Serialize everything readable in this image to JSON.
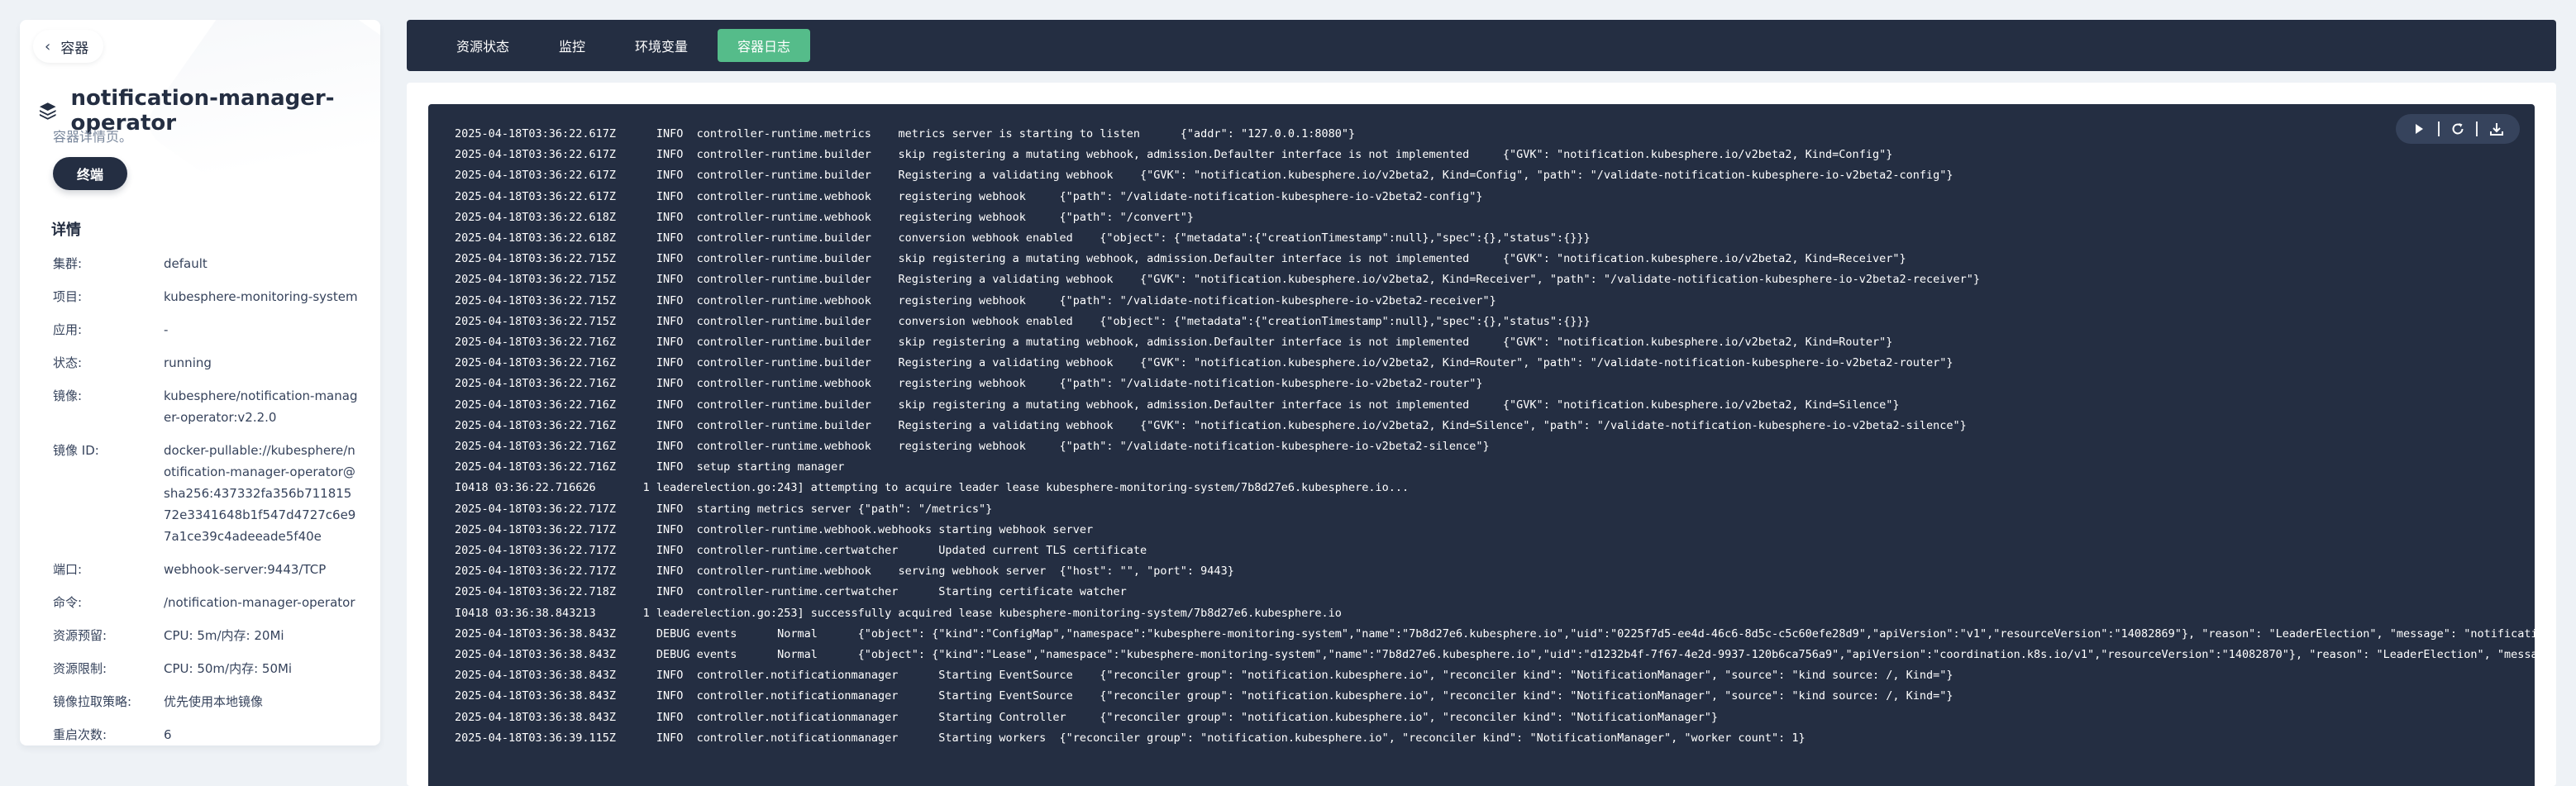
{
  "back": {
    "label": "容器"
  },
  "header": {
    "title": "notification-manager-operator",
    "subtitle": "容器详情页。",
    "terminal_label": "终端"
  },
  "details": {
    "heading": "详情",
    "rows": [
      {
        "key": "集群:",
        "value": "default"
      },
      {
        "key": "项目:",
        "value": "kubesphere-monitoring-system"
      },
      {
        "key": "应用:",
        "value": "-"
      },
      {
        "key": "状态:",
        "value": "running"
      },
      {
        "key": "镜像:",
        "value": "kubesphere/notification-manager-operator:v2.2.0"
      },
      {
        "key": "镜像 ID:",
        "value": "docker-pullable://kubesphere/notification-manager-operator@sha256:437332fa356b71181572e3341648b1f547d4727c6e97a1ce39c4adeeade5f40e"
      },
      {
        "key": "端口:",
        "value": "webhook-server:9443/TCP"
      },
      {
        "key": "命令:",
        "value": "/notification-manager-operator"
      },
      {
        "key": "资源预留:",
        "value": "CPU:  5m/内存:  20Mi"
      },
      {
        "key": "资源限制:",
        "value": "CPU:  50m/内存:  50Mi"
      },
      {
        "key": "镜像拉取策略:",
        "value": "优先使用本地镜像"
      },
      {
        "key": "重启次数:",
        "value": "6"
      }
    ]
  },
  "tabs": [
    {
      "label": "资源状态",
      "active": false
    },
    {
      "label": "监控",
      "active": false
    },
    {
      "label": "环境变量",
      "active": false
    },
    {
      "label": "容器日志",
      "active": true
    }
  ],
  "logs": [
    "2025-04-18T03:36:22.617Z\tINFO\tcontroller-runtime.metrics\tmetrics server is starting to listen\t{\"addr\": \"127.0.0.1:8080\"}",
    "2025-04-18T03:36:22.617Z\tINFO\tcontroller-runtime.builder\tskip registering a mutating webhook, admission.Defaulter interface is not implemented\t{\"GVK\": \"notification.kubesphere.io/v2beta2, Kind=Config\"}",
    "2025-04-18T03:36:22.617Z\tINFO\tcontroller-runtime.builder\tRegistering a validating webhook\t{\"GVK\": \"notification.kubesphere.io/v2beta2, Kind=Config\", \"path\": \"/validate-notification-kubesphere-io-v2beta2-config\"}",
    "2025-04-18T03:36:22.617Z\tINFO\tcontroller-runtime.webhook\tregistering webhook\t{\"path\": \"/validate-notification-kubesphere-io-v2beta2-config\"}",
    "2025-04-18T03:36:22.618Z\tINFO\tcontroller-runtime.webhook\tregistering webhook\t{\"path\": \"/convert\"}",
    "2025-04-18T03:36:22.618Z\tINFO\tcontroller-runtime.builder\tconversion webhook enabled\t{\"object\": {\"metadata\":{\"creationTimestamp\":null},\"spec\":{},\"status\":{}}}",
    "2025-04-18T03:36:22.715Z\tINFO\tcontroller-runtime.builder\tskip registering a mutating webhook, admission.Defaulter interface is not implemented\t{\"GVK\": \"notification.kubesphere.io/v2beta2, Kind=Receiver\"}",
    "2025-04-18T03:36:22.715Z\tINFO\tcontroller-runtime.builder\tRegistering a validating webhook\t{\"GVK\": \"notification.kubesphere.io/v2beta2, Kind=Receiver\", \"path\": \"/validate-notification-kubesphere-io-v2beta2-receiver\"}",
    "2025-04-18T03:36:22.715Z\tINFO\tcontroller-runtime.webhook\tregistering webhook\t{\"path\": \"/validate-notification-kubesphere-io-v2beta2-receiver\"}",
    "2025-04-18T03:36:22.715Z\tINFO\tcontroller-runtime.builder\tconversion webhook enabled\t{\"object\": {\"metadata\":{\"creationTimestamp\":null},\"spec\":{},\"status\":{}}}",
    "2025-04-18T03:36:22.716Z\tINFO\tcontroller-runtime.builder\tskip registering a mutating webhook, admission.Defaulter interface is not implemented\t{\"GVK\": \"notification.kubesphere.io/v2beta2, Kind=Router\"}",
    "2025-04-18T03:36:22.716Z\tINFO\tcontroller-runtime.builder\tRegistering a validating webhook\t{\"GVK\": \"notification.kubesphere.io/v2beta2, Kind=Router\", \"path\": \"/validate-notification-kubesphere-io-v2beta2-router\"}",
    "2025-04-18T03:36:22.716Z\tINFO\tcontroller-runtime.webhook\tregistering webhook\t{\"path\": \"/validate-notification-kubesphere-io-v2beta2-router\"}",
    "2025-04-18T03:36:22.716Z\tINFO\tcontroller-runtime.builder\tskip registering a mutating webhook, admission.Defaulter interface is not implemented\t{\"GVK\": \"notification.kubesphere.io/v2beta2, Kind=Silence\"}",
    "2025-04-18T03:36:22.716Z\tINFO\tcontroller-runtime.builder\tRegistering a validating webhook\t{\"GVK\": \"notification.kubesphere.io/v2beta2, Kind=Silence\", \"path\": \"/validate-notification-kubesphere-io-v2beta2-silence\"}",
    "2025-04-18T03:36:22.716Z\tINFO\tcontroller-runtime.webhook\tregistering webhook\t{\"path\": \"/validate-notification-kubesphere-io-v2beta2-silence\"}",
    "2025-04-18T03:36:22.716Z\tINFO\tsetup\tstarting manager",
    "I0418 03:36:22.716626       1 leaderelection.go:243] attempting to acquire leader lease kubesphere-monitoring-system/7b8d27e6.kubesphere.io...",
    "2025-04-18T03:36:22.717Z\tINFO\tstarting metrics server\t{\"path\": \"/metrics\"}",
    "2025-04-18T03:36:22.717Z\tINFO\tcontroller-runtime.webhook.webhooks\tstarting webhook server",
    "2025-04-18T03:36:22.717Z\tINFO\tcontroller-runtime.certwatcher\tUpdated current TLS certificate",
    "2025-04-18T03:36:22.717Z\tINFO\tcontroller-runtime.webhook\tserving webhook server\t{\"host\": \"\", \"port\": 9443}",
    "2025-04-18T03:36:22.718Z\tINFO\tcontroller-runtime.certwatcher\tStarting certificate watcher",
    "I0418 03:36:38.843213       1 leaderelection.go:253] successfully acquired lease kubesphere-monitoring-system/7b8d27e6.kubesphere.io",
    "2025-04-18T03:36:38.843Z\tDEBUG\tevents\tNormal\t{\"object\": {\"kind\":\"ConfigMap\",\"namespace\":\"kubesphere-monitoring-system\",\"name\":\"7b8d27e6.kubesphere.io\",\"uid\":\"0225f7d5-ee4d-46c6-8d5c-c5c60efe28d9\",\"apiVersion\":\"v1\",\"resourceVersion\":\"14082869\"}, \"reason\": \"LeaderElection\", \"message\": \"notificatio",
    "2025-04-18T03:36:38.843Z\tDEBUG\tevents\tNormal\t{\"object\": {\"kind\":\"Lease\",\"namespace\":\"kubesphere-monitoring-system\",\"name\":\"7b8d27e6.kubesphere.io\",\"uid\":\"d1232b4f-7f67-4e2d-9937-120b6ca756a9\",\"apiVersion\":\"coordination.k8s.io/v1\",\"resourceVersion\":\"14082870\"}, \"reason\": \"LeaderElection\", \"messag",
    "2025-04-18T03:36:38.843Z\tINFO\tcontroller.notificationmanager\tStarting EventSource\t{\"reconciler group\": \"notification.kubesphere.io\", \"reconciler kind\": \"NotificationManager\", \"source\": \"kind source: /, Kind=\"}",
    "2025-04-18T03:36:38.843Z\tINFO\tcontroller.notificationmanager\tStarting EventSource\t{\"reconciler group\": \"notification.kubesphere.io\", \"reconciler kind\": \"NotificationManager\", \"source\": \"kind source: /, Kind=\"}",
    "2025-04-18T03:36:38.843Z\tINFO\tcontroller.notificationmanager\tStarting Controller\t{\"reconciler group\": \"notification.kubesphere.io\", \"reconciler kind\": \"NotificationManager\"}",
    "2025-04-18T03:36:39.115Z\tINFO\tcontroller.notificationmanager\tStarting workers\t{\"reconciler group\": \"notification.kubesphere.io\", \"reconciler kind\": \"NotificationManager\", \"worker count\": 1}"
  ],
  "toolbar": {
    "icons": [
      "play-icon",
      "refresh-icon",
      "download-icon"
    ]
  },
  "colors": {
    "dark": "#242e42",
    "accent": "#55bc8a",
    "toolbar_bg": "#36435c"
  }
}
